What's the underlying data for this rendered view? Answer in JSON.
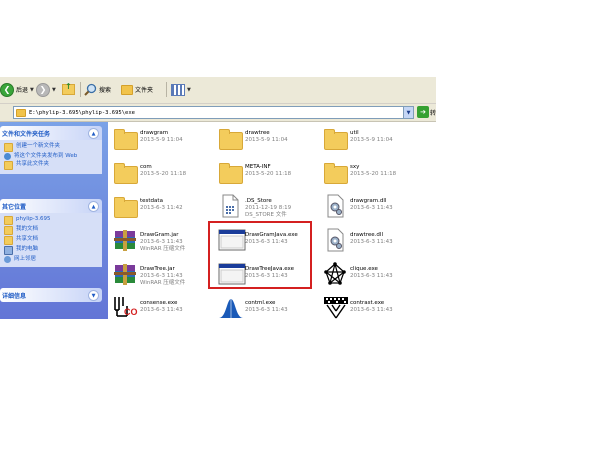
{
  "toolbar": {
    "back_label": "后退",
    "search_label": "搜索",
    "folders_label": "文件夹"
  },
  "address": {
    "path": "E:\\phylip-3.695\\phylip-3.695\\exe",
    "go_label": "转"
  },
  "left_panel": {
    "tasks": {
      "title": "文件和文件夹任务",
      "items": [
        {
          "label": "创建一个新文件夹"
        },
        {
          "label": "将这个文件夹发布到 Web"
        },
        {
          "label": "共享此文件夹"
        }
      ]
    },
    "places": {
      "title": "其它位置",
      "items": [
        {
          "label": "phylip-3.695"
        },
        {
          "label": "我的文档"
        },
        {
          "label": "共享文档"
        },
        {
          "label": "我的电脑"
        },
        {
          "label": "网上邻居"
        }
      ]
    },
    "details": {
      "title": "详细信息"
    }
  },
  "files": [
    {
      "name": "drawgram",
      "info": "2013-5-9 11:04",
      "kind": "folder"
    },
    {
      "name": "drawtree",
      "info": "2013-5-9 11:04",
      "kind": "folder"
    },
    {
      "name": "util",
      "info": "2013-5-9 11:04",
      "kind": "folder"
    },
    {
      "name": "com",
      "info": "2013-5-20 11:18",
      "kind": "folder"
    },
    {
      "name": "META-INF",
      "info": "2013-5-20 11:18",
      "kind": "folder"
    },
    {
      "name": "sxy",
      "info": "2013-5-20 11:18",
      "kind": "folder"
    },
    {
      "name": "testdata",
      "info": "2013-6-3 11:42",
      "kind": "folder"
    },
    {
      "name": ".DS_Store",
      "info": "2011-12-19 8:19",
      "info2": "DS_STORE 文件",
      "kind": "doc"
    },
    {
      "name": "drawgram.dll",
      "info": "2013-6-3 11:43",
      "kind": "dll"
    },
    {
      "name": "DrawGram.jar",
      "info": "2013-6-3 11:43",
      "info2": "WinRAR 压缩文件",
      "kind": "rar"
    },
    {
      "name": "DrawGramJava.exe",
      "info": "2013-6-3 11:43",
      "kind": "exe"
    },
    {
      "name": "drawtree.dll",
      "info": "2013-6-3 11:43",
      "kind": "dll"
    },
    {
      "name": "DrawTree.jar",
      "info": "2013-6-3 11:43",
      "info2": "WinRAR 压缩文件",
      "kind": "rar"
    },
    {
      "name": "DrawTreeJava.exe",
      "info": "2013-6-3 11:43",
      "kind": "exe"
    },
    {
      "name": "clique.exe",
      "info": "2013-6-3 11:43",
      "kind": "clique"
    },
    {
      "name": "consense.exe",
      "info": "2013-6-3 11:43",
      "kind": "consense"
    },
    {
      "name": "contml.exe",
      "info": "2013-6-3 11:43",
      "kind": "contml"
    },
    {
      "name": "contrast.exe",
      "info": "2013-6-3 11:43",
      "kind": "contrast"
    }
  ],
  "colors": {
    "highlight_box": "#d42020",
    "panel_text": "#215dc6"
  }
}
